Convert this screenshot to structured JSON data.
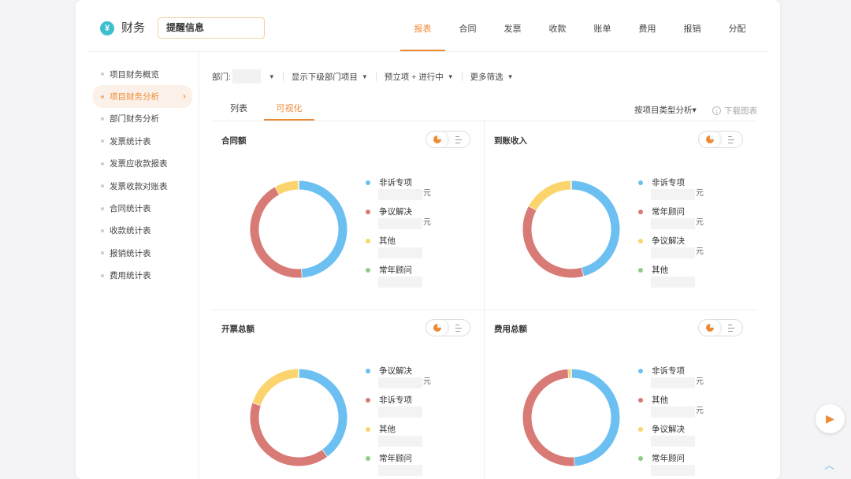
{
  "header": {
    "logo_glyph": "¥",
    "title": "财务",
    "search_value": "提醒信息",
    "nav": [
      "报表",
      "合同",
      "发票",
      "收款",
      "账单",
      "费用",
      "报销",
      "分配"
    ],
    "active_nav": 0
  },
  "sidebar": {
    "items": [
      "项目财务概览",
      "项目财务分析",
      "部门财务分析",
      "发票统计表",
      "发票应收款报表",
      "发票收款对账表",
      "合同统计表",
      "收款统计表",
      "报销统计表",
      "费用统计表"
    ],
    "active_index": 1
  },
  "filters": {
    "dept_label": "部门:",
    "include_sub": "显示下级部门项目",
    "status": "预立项 + 进行中",
    "more": "更多筛选"
  },
  "tabs": {
    "list": "列表",
    "visual": "可视化",
    "analyze_by": "按项目类型分析",
    "download": "下载图表"
  },
  "colors": {
    "blue": "#6cc0f1",
    "red": "#d87a75",
    "yellow": "#fbd46d",
    "green": "#8fcc86",
    "accent": "#ef8a34"
  },
  "panels": [
    {
      "title": "合同额",
      "segments": [
        {
          "name": "非诉专项",
          "color": "blue",
          "fraction": 0.49,
          "unit": "元"
        },
        {
          "name": "争议解决",
          "color": "red",
          "fraction": 0.43,
          "unit": "元"
        },
        {
          "name": "其他",
          "color": "yellow",
          "fraction": 0.08,
          "unit": ""
        },
        {
          "name": "常年顾问",
          "color": "green",
          "fraction": 0.0,
          "unit": ""
        }
      ]
    },
    {
      "title": "到账收入",
      "segments": [
        {
          "name": "非诉专项",
          "color": "blue",
          "fraction": 0.46,
          "unit": "元"
        },
        {
          "name": "常年顾问",
          "color": "red",
          "fraction": 0.37,
          "unit": "元"
        },
        {
          "name": "争议解决",
          "color": "yellow",
          "fraction": 0.17,
          "unit": "元"
        },
        {
          "name": "其他",
          "color": "green",
          "fraction": 0.0,
          "unit": ""
        }
      ]
    },
    {
      "title": "开票总额",
      "segments": [
        {
          "name": "争议解决",
          "color": "blue",
          "fraction": 0.4,
          "unit": "元"
        },
        {
          "name": "非诉专项",
          "color": "red",
          "fraction": 0.4,
          "unit": ""
        },
        {
          "name": "其他",
          "color": "yellow",
          "fraction": 0.2,
          "unit": ""
        },
        {
          "name": "常年顾问",
          "color": "green",
          "fraction": 0.0,
          "unit": ""
        }
      ]
    },
    {
      "title": "费用总额",
      "segments": [
        {
          "name": "非诉专项",
          "color": "blue",
          "fraction": 0.49,
          "unit": "元"
        },
        {
          "name": "其他",
          "color": "red",
          "fraction": 0.5,
          "unit": "元"
        },
        {
          "name": "争议解决",
          "color": "yellow",
          "fraction": 0.01,
          "unit": ""
        },
        {
          "name": "常年顾问",
          "color": "green",
          "fraction": 0.0,
          "unit": ""
        }
      ]
    }
  ]
}
